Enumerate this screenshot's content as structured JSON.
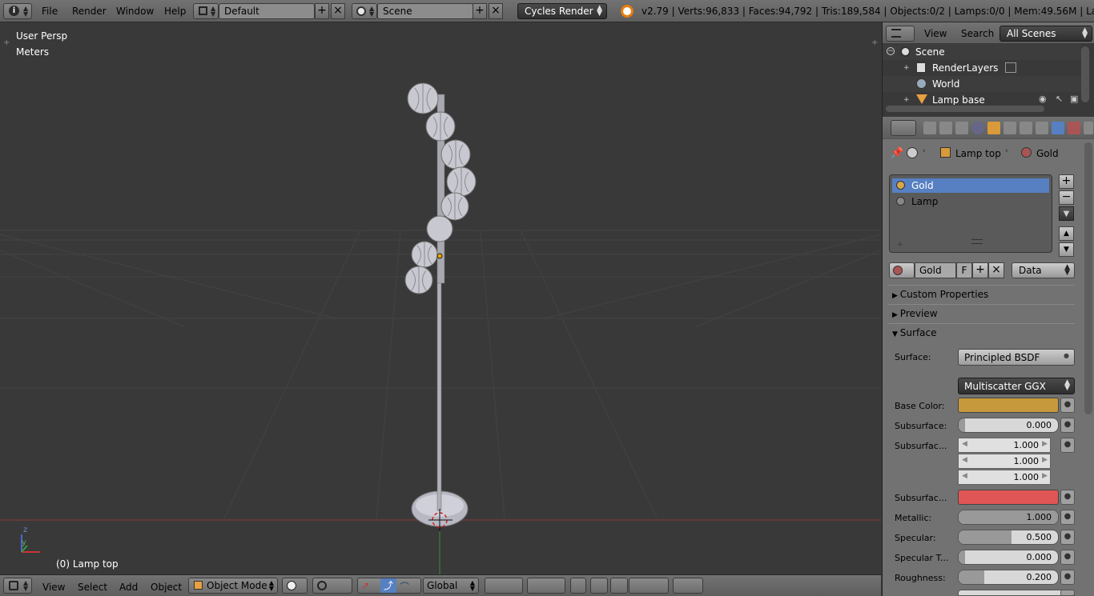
{
  "topbar": {
    "menus": [
      "File",
      "Render",
      "Window",
      "Help"
    ],
    "layout": "Default",
    "scene": "Scene",
    "engine": "Cycles Render",
    "stats": "v2.79 | Verts:96,833 | Faces:94,792 | Tris:189,584 | Objects:0/2 | Lamps:0/0 | Mem:49.56M | Lamp top"
  },
  "viewport": {
    "persp": "User Persp",
    "units": "Meters",
    "active_object": "(0) Lamp top",
    "axis_z": "z",
    "axis_y": "y"
  },
  "bottombar": {
    "menus": [
      "View",
      "Select",
      "Add",
      "Object"
    ],
    "mode": "Object Mode",
    "orientation": "Global"
  },
  "outliner": {
    "view": "View",
    "search": "Search",
    "filter": "All Scenes",
    "items": [
      "Scene",
      "RenderLayers",
      "World",
      "Lamp base"
    ]
  },
  "properties": {
    "breadcrumb_object": "Lamp top",
    "breadcrumb_material": "Gold",
    "slots": [
      "Gold",
      "Lamp"
    ],
    "material_name": "Gold",
    "fake_user": "F",
    "link": "Data",
    "panels": [
      "Custom Properties",
      "Preview",
      "Surface"
    ],
    "surface_label": "Surface:",
    "surface_shader": "Principled BSDF",
    "distribution": "Multiscatter GGX",
    "params": {
      "base_color_label": "Base Color:",
      "base_color": "#c69a3c",
      "subsurface_label": "Subsurface:",
      "subsurface": "0.000",
      "subsurface_radius_label": "Subsurfac...",
      "radius": [
        "1.000",
        "1.000",
        "1.000"
      ],
      "subsurface_color_label": "Subsurfac...",
      "subsurface_color": "#e05555",
      "metallic_label": "Metallic:",
      "metallic": "1.000",
      "specular_label": "Specular:",
      "specular": "0.500",
      "specular_tint_label": "Specular T...",
      "specular_tint": "0.000",
      "roughness_label": "Roughness:",
      "roughness": "0.200"
    }
  }
}
